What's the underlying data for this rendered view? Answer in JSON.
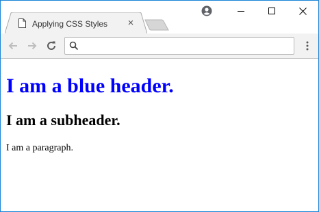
{
  "browser": {
    "tab": {
      "title": "Applying CSS Styles",
      "close_glyph": "×",
      "favicon": "page-icon"
    },
    "newtab": {
      "icon": "new-tab-icon"
    },
    "profile": {
      "icon": "profile-icon"
    },
    "window_controls": {
      "minimize": "minimize-icon",
      "maximize": "maximize-icon",
      "close": "close-icon"
    },
    "toolbar": {
      "back": "back-arrow-icon",
      "forward": "forward-arrow-icon",
      "reload": "reload-icon",
      "menu": "kebab-menu-icon"
    },
    "omnibox": {
      "value": "",
      "placeholder": "",
      "icon": "search-icon"
    }
  },
  "page": {
    "heading": "I am a blue header.",
    "subheading": "I am a subheader.",
    "paragraph": "I am a paragraph."
  },
  "colors": {
    "heading": "#0000ff",
    "window_border": "#1883d7",
    "toolbar_bg": "#f2f2f2"
  }
}
